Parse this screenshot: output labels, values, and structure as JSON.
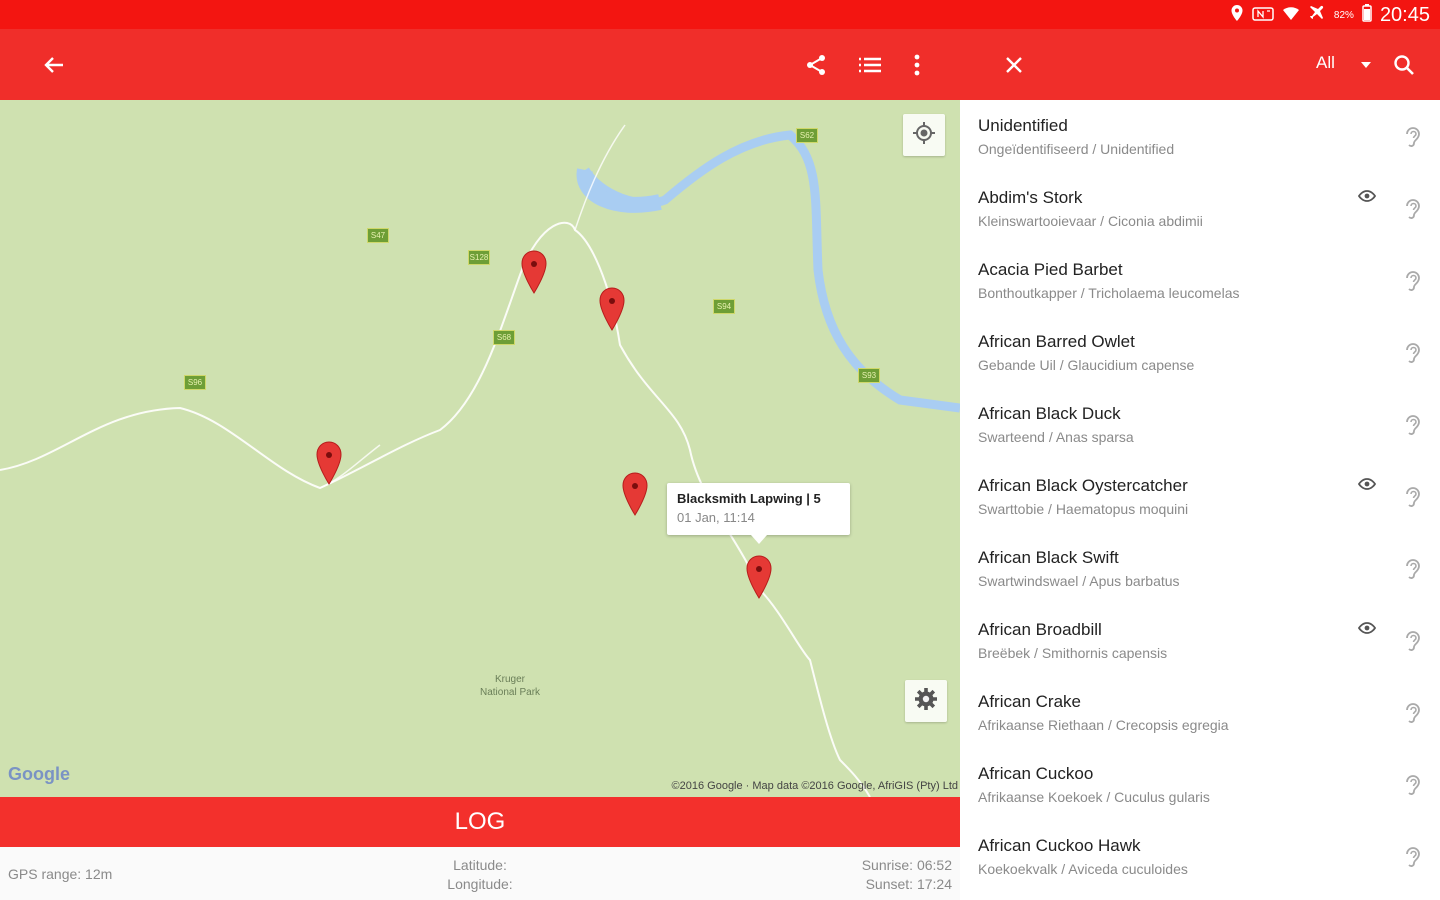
{
  "status_bar": {
    "time": "20:45",
    "battery": "82%",
    "icons": [
      "location-icon",
      "nfc-icon",
      "wifi-icon",
      "airplane-icon",
      "battery-icon"
    ]
  },
  "toolbar": {
    "left_icons": [
      "back-arrow-icon",
      "share-icon",
      "list-icon",
      "more-vert-icon"
    ],
    "right_icons": [
      "close-icon",
      "dropdown-arrow-icon",
      "search-icon"
    ],
    "filter_label": "All"
  },
  "map": {
    "road_badges": [
      "S62",
      "S47",
      "S128",
      "S68",
      "S94",
      "S96",
      "S93"
    ],
    "callout": {
      "title": "Blacksmith Lapwing | 5",
      "subtitle": "01 Jan, 11:14"
    },
    "logo": "Google",
    "attribution": "©2016 Google · Map data ©2016 Google, AfriGIS (Pty) Ltd",
    "place_label": [
      "Kruger",
      "National Park"
    ],
    "controls": [
      "my-location-icon",
      "settings-icon"
    ],
    "pin_icon": "map-pin-icon"
  },
  "log_button": "LOG",
  "footer": {
    "gps_range": "GPS range: 12m",
    "latitude": "Latitude:",
    "longitude": "Longitude:",
    "sunrise": "Sunrise: 06:52",
    "sunset": "Sunset: 17:24"
  },
  "species": [
    {
      "name": "Unidentified",
      "sub": "Ongeïdentifiseerd / Unidentified",
      "spotted": false
    },
    {
      "name": "Abdim's Stork",
      "sub": "Kleinswartooievaar / Ciconia abdimii",
      "spotted": true
    },
    {
      "name": "Acacia Pied Barbet",
      "sub": "Bonthoutkapper / Tricholaema leucomelas",
      "spotted": false
    },
    {
      "name": "African Barred Owlet",
      "sub": "Gebande Uil / Glaucidium capense",
      "spotted": false
    },
    {
      "name": "African Black Duck",
      "sub": "Swarteend / Anas sparsa",
      "spotted": false
    },
    {
      "name": "African Black Oystercatcher",
      "sub": "Swarttobie / Haematopus moquini",
      "spotted": true
    },
    {
      "name": "African Black Swift",
      "sub": "Swartwindswael / Apus barbatus",
      "spotted": false
    },
    {
      "name": "African Broadbill",
      "sub": "Breëbek / Smithornis capensis",
      "spotted": true
    },
    {
      "name": "African Crake",
      "sub": "Afrikaanse Riethaan / Crecopsis egregia",
      "spotted": false
    },
    {
      "name": "African Cuckoo",
      "sub": "Afrikaanse Koekoek / Cuculus gularis",
      "spotted": false
    },
    {
      "name": "African Cuckoo Hawk",
      "sub": "Koekoekvalk / Aviceda cuculoides",
      "spotted": false
    }
  ],
  "colors": {
    "primary": "#f02e2a",
    "status_bar": "#f31511",
    "map_land": "#cfe1b0",
    "water": "#a9cdf2",
    "pin": "#e53935"
  }
}
